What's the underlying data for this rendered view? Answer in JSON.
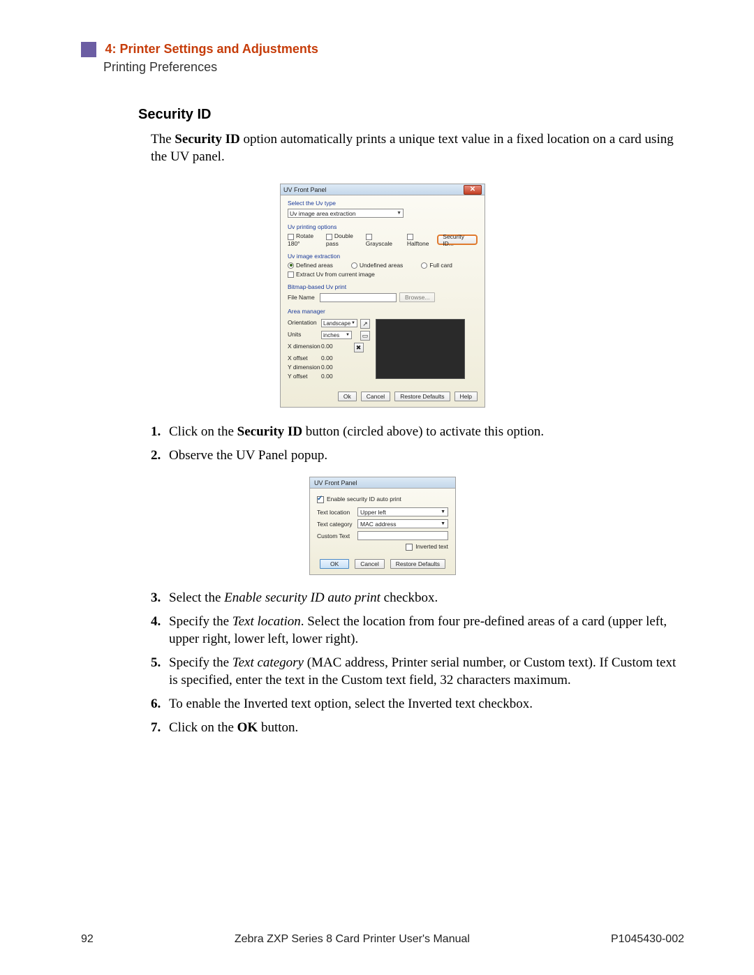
{
  "chapter": {
    "number_title": "4: Printer Settings and Adjustments",
    "subtitle": "Printing Preferences"
  },
  "section_heading": "Security ID",
  "intro": {
    "pre": "The ",
    "bold": "Security ID",
    "post": " option automatically prints a unique text value in a fixed location on a card using the UV panel."
  },
  "dlg1": {
    "title": "UV Front Panel",
    "select_label": "Select the Uv type",
    "select_value": "Uv image area extraction",
    "options_label": "Uv printing options",
    "cb_rotate": "Rotate 180°",
    "cb_double": "Double pass",
    "cb_gray": "Grayscale",
    "cb_half": "Halftone",
    "btn_security": "Security ID...",
    "extract_label": "Uv image extraction",
    "rad_defined": "Defined areas",
    "rad_undef": "Undefined areas",
    "rad_full": "Full card",
    "cb_extract": "Extract Uv from current image",
    "bitmap_label": "Bitmap-based Uv print",
    "file_label": "File Name",
    "btn_browse": "Browse...",
    "area_label": "Area manager",
    "orientation_l": "Orientation",
    "orientation_v": "Landscape",
    "units_l": "Units",
    "units_v": "inches",
    "xdim_l": "X dimension",
    "xdim_v": "0.00",
    "xoff_l": "X offset",
    "xoff_v": "0.00",
    "ydim_l": "Y dimension",
    "ydim_v": "0.00",
    "yoff_l": "Y offset",
    "yoff_v": "0.00",
    "btn_ok": "Ok",
    "btn_cancel": "Cancel",
    "btn_restore": "Restore Defaults",
    "btn_help": "Help"
  },
  "dlg2": {
    "title": "UV Front Panel",
    "cb_enable": "Enable security ID auto print",
    "loc_l": "Text location",
    "loc_v": "Upper left",
    "cat_l": "Text category",
    "cat_v": "MAC address",
    "custom_l": "Custom Text",
    "cb_inverted": "Inverted text",
    "btn_ok": "OK",
    "btn_cancel": "Cancel",
    "btn_restore": "Restore Defaults"
  },
  "steps": {
    "s1": {
      "pre": "Click on the ",
      "bold": "Security ID",
      "post": " button (circled above) to activate this option."
    },
    "s2": "Observe the UV Panel popup.",
    "s3": {
      "pre": "Select the ",
      "italic": "Enable security ID auto print",
      "post": " checkbox."
    },
    "s4": {
      "pre": "Specify the ",
      "italic": "Text location",
      "post": ". Select the location from four pre-defined areas of a card (upper left, upper right, lower left, lower right)."
    },
    "s5": {
      "pre": "Specify the ",
      "italic": "Text category",
      "post": " (MAC address, Printer serial number, or Custom text). If Custom text is specified, enter the text in the Custom text field, 32 characters maximum."
    },
    "s6": "To enable the Inverted text option, select the Inverted text checkbox.",
    "s7": {
      "pre": "Click on the ",
      "bold": "OK",
      "post": " button."
    }
  },
  "footer": {
    "page": "92",
    "center": "Zebra ZXP Series 8 Card Printer User's Manual",
    "right": "P1045430-002"
  }
}
